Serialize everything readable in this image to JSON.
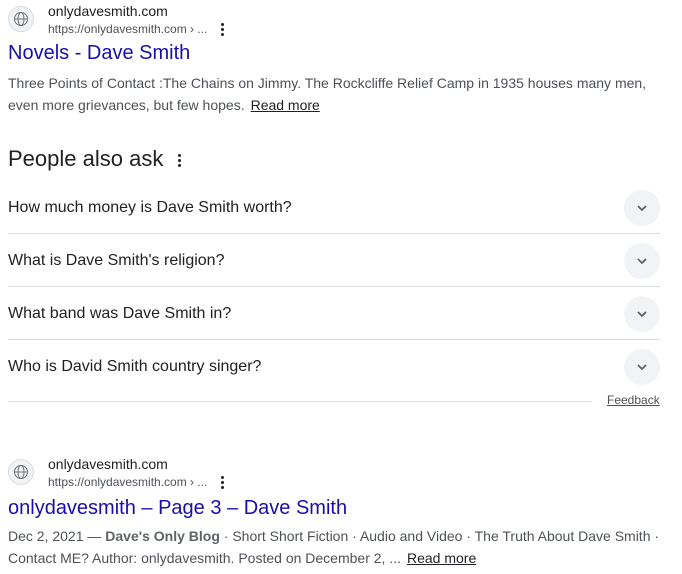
{
  "result1": {
    "site_name": "onlydavesmith.com",
    "url": "https://onlydavesmith.com › ...",
    "title": "Novels - Dave Smith",
    "snippet_line1": "Three Points of Contact :The Chains on Jimmy. The Rockcliffe Relief Camp in 1935 houses many men,",
    "snippet_line2": "even more grievances, but few hopes.",
    "read_more": "Read more",
    "favicon_icon": "globe-icon",
    "menu_icon": "more-vert-icon"
  },
  "people_also_ask": {
    "title": "People also ask",
    "menu_icon": "more-vert-icon",
    "questions": [
      "How much money is Dave Smith worth?",
      "What is Dave Smith's religion?",
      "What band was Dave Smith in?",
      "Who is David Smith country singer?"
    ],
    "expand_icon": "chevron-down-icon",
    "feedback": "Feedback"
  },
  "result2": {
    "site_name": "onlydavesmith.com",
    "url": "https://onlydavesmith.com › ...",
    "title": "onlydavesmith – Page 3 – Dave Smith",
    "date": "Dec 2, 2021",
    "dash": " — ",
    "blog_name": "Dave's Only Blog",
    "snippet_rest_line1": " · Short Short Fiction · Audio and Video · The Truth About Dave Smith ·",
    "snippet_line2": "Contact ME? Author: onlydavesmith. Posted on December 2, ...",
    "read_more": "Read more",
    "favicon_icon": "globe-icon",
    "menu_icon": "more-vert-icon"
  }
}
